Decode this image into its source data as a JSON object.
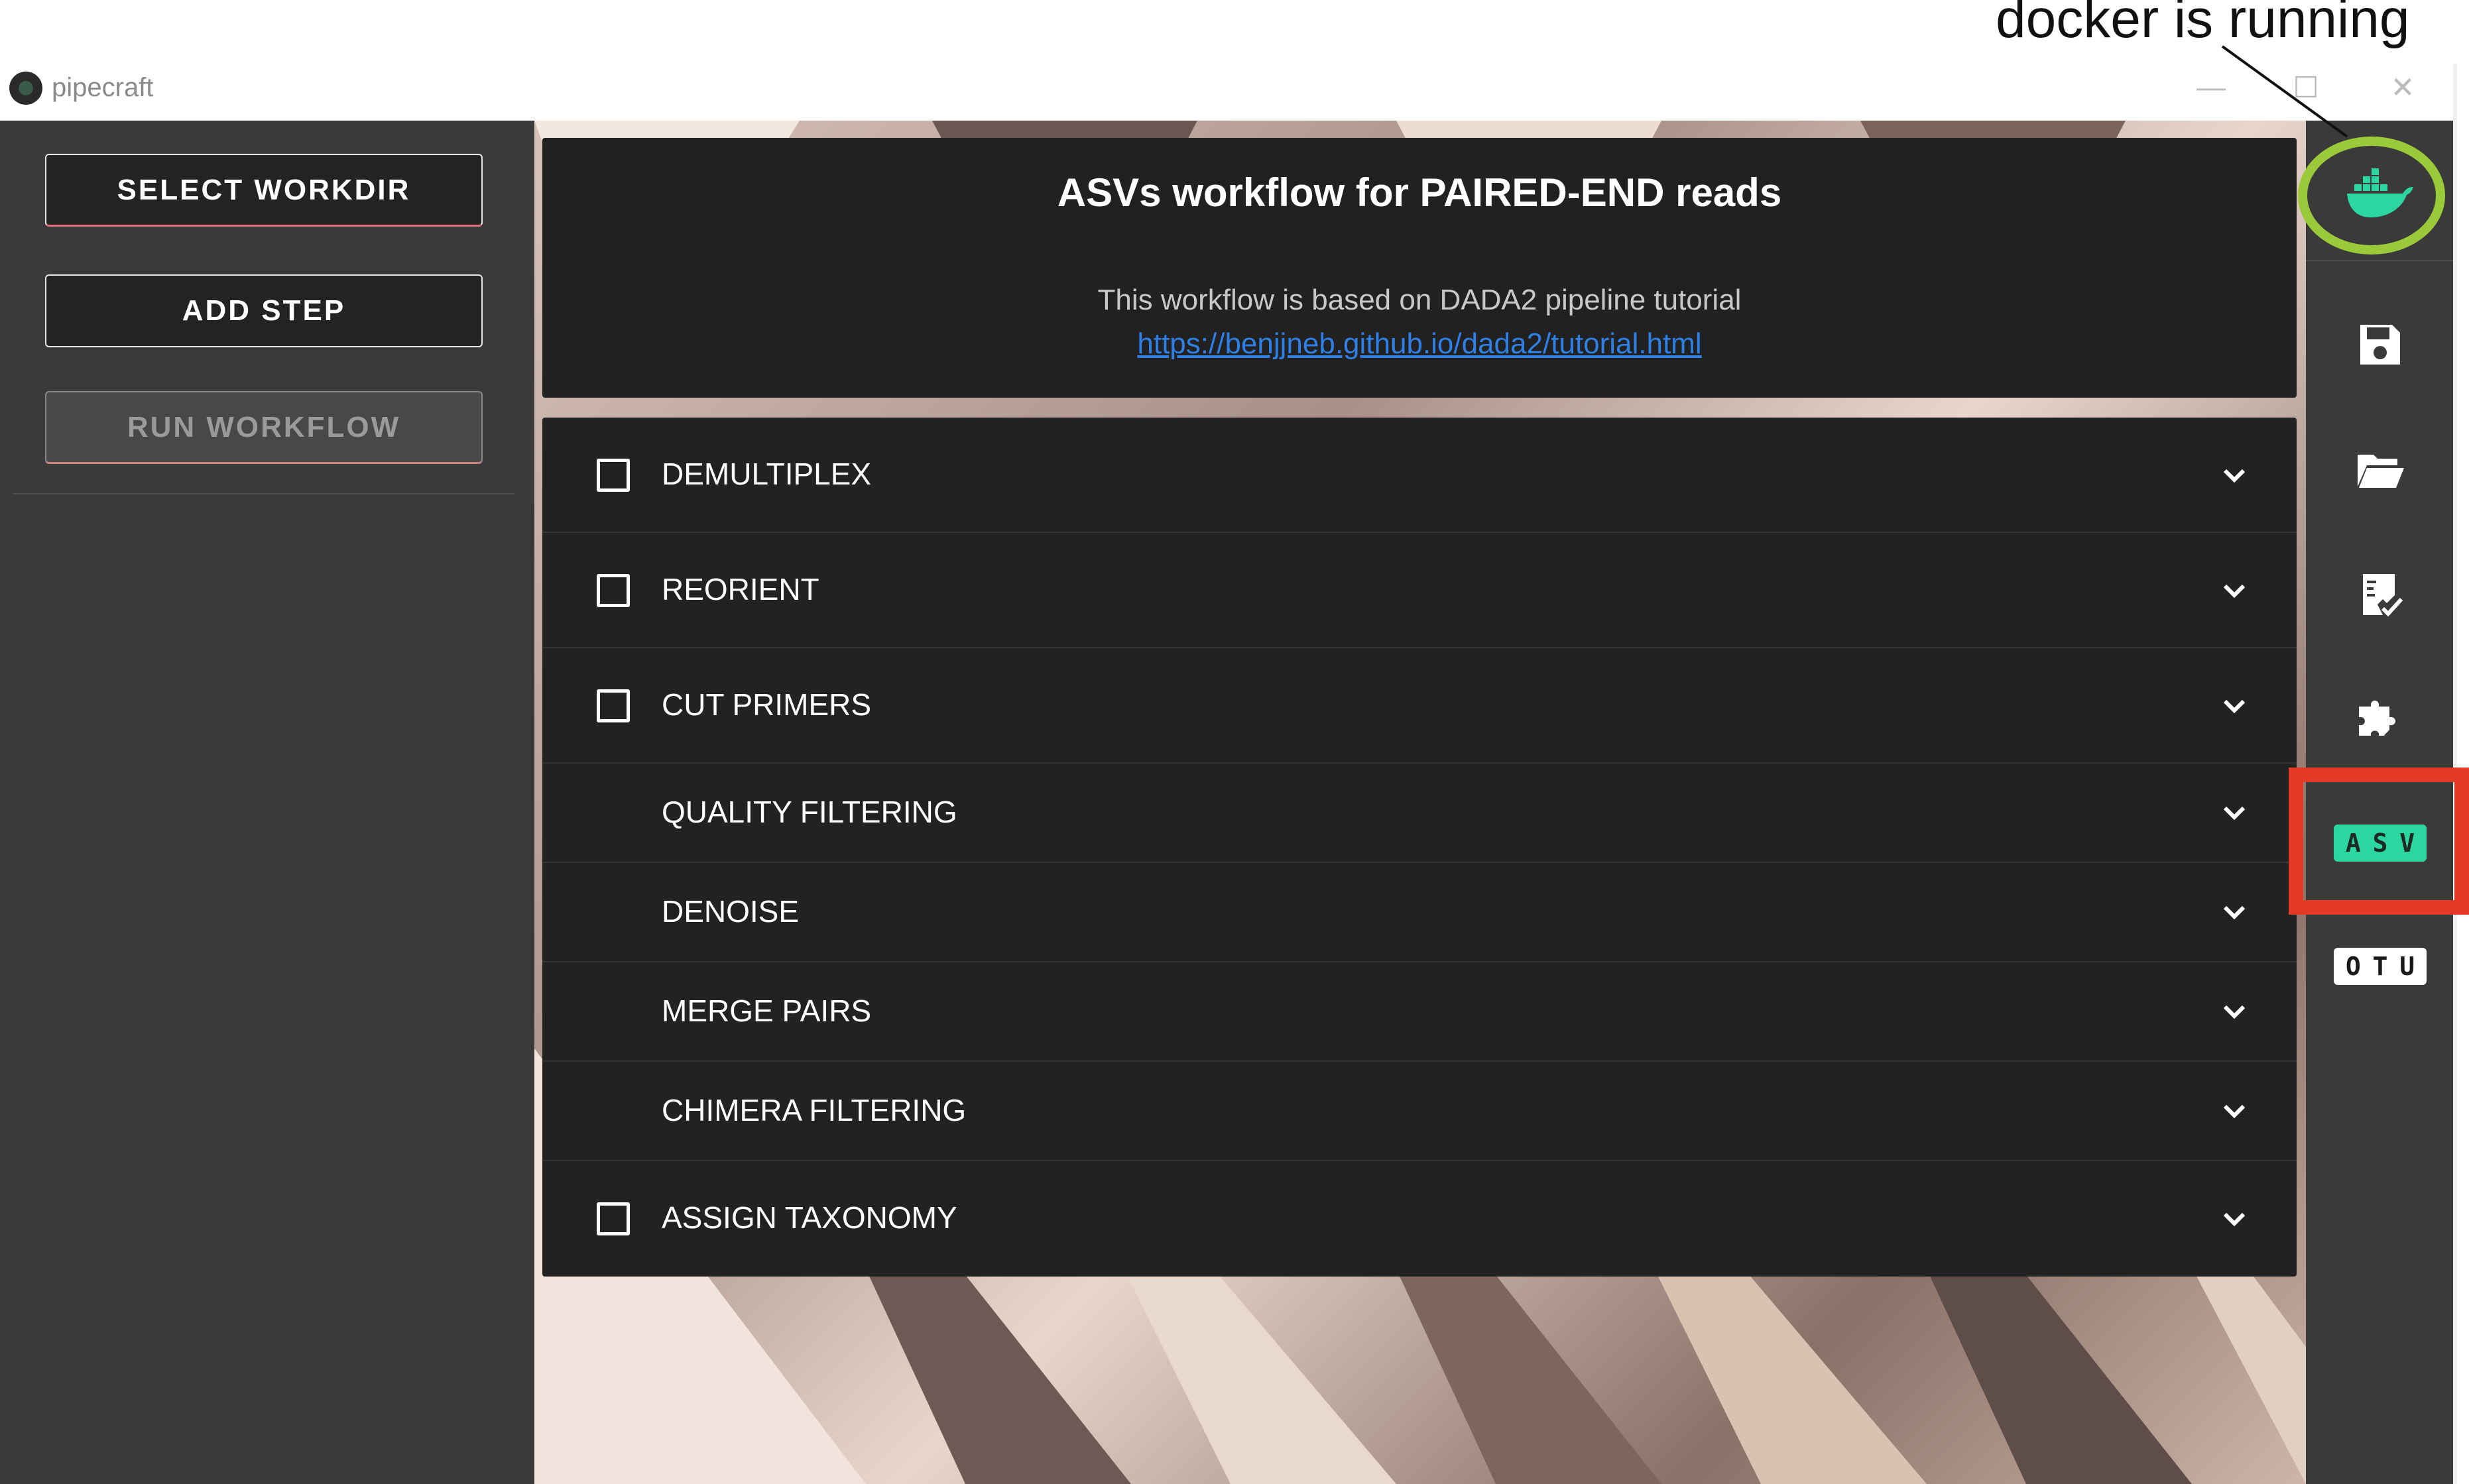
{
  "annotation": {
    "text": "docker is running"
  },
  "window": {
    "title": "pipecraft",
    "minimize": "—",
    "maximize": "☐",
    "close": "✕"
  },
  "sidebar": {
    "select_workdir": "SELECT WORKDIR",
    "add_step": "ADD STEP",
    "run_workflow": "RUN WORKFLOW"
  },
  "workflow": {
    "title": "ASVs workflow for PAIRED-END reads",
    "description": "This workflow is based on DADA2 pipeline tutorial",
    "link": "https://benjjneb.github.io/dada2/tutorial.html",
    "steps": [
      {
        "label": "DEMULTIPLEX",
        "optional": true
      },
      {
        "label": "REORIENT",
        "optional": true
      },
      {
        "label": "CUT PRIMERS",
        "optional": true
      },
      {
        "label": "QUALITY FILTERING",
        "optional": false
      },
      {
        "label": "DENOISE",
        "optional": false
      },
      {
        "label": "MERGE PAIRS",
        "optional": false
      },
      {
        "label": "CHIMERA FILTERING",
        "optional": false
      },
      {
        "label": "ASSIGN TAXONOMY",
        "optional": true
      }
    ]
  },
  "rail": {
    "icons": [
      "docker-icon",
      "save-icon",
      "folder-open-icon",
      "checklist-icon",
      "puzzle-icon"
    ],
    "asv_badge": [
      "A",
      "S",
      "V"
    ],
    "otu_badge": [
      "O",
      "T",
      "U"
    ]
  },
  "colors": {
    "accent_green": "#2bd6a0",
    "highlight_red": "#e23a24",
    "highlight_green": "#9ac93a",
    "link": "#2f80e6"
  }
}
